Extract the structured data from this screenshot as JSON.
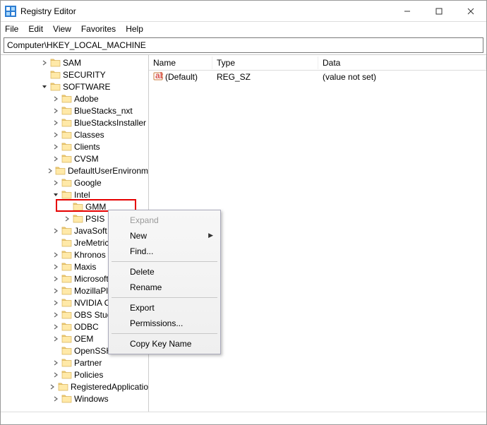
{
  "window": {
    "title": "Registry Editor"
  },
  "menu": {
    "file": "File",
    "edit": "Edit",
    "view": "View",
    "favorites": "Favorites",
    "help": "Help"
  },
  "address": "Computer\\HKEY_LOCAL_MACHINE",
  "list": {
    "headers": {
      "name": "Name",
      "type": "Type",
      "data": "Data"
    },
    "rows": [
      {
        "name": "(Default)",
        "type": "REG_SZ",
        "data": "(value not set)"
      }
    ]
  },
  "tree": {
    "sam": "SAM",
    "security": "SECURITY",
    "software": "SOFTWARE",
    "adobe": "Adobe",
    "bluestacks_nxt": "BlueStacks_nxt",
    "bluestacksinstaller": "BlueStacksInstaller",
    "classes": "Classes",
    "clients": "Clients",
    "cvsm": "CVSM",
    "defaultuserenv": "DefaultUserEnvironm",
    "google": "Google",
    "intel": "Intel",
    "gmm": "GMM",
    "psis": "PSIS",
    "javasoft": "JavaSoft",
    "jremetrics": "JreMetrics",
    "khronos": "Khronos",
    "maxis": "Maxis",
    "microsoft": "Microsoft",
    "mozillaplug": "MozillaPlug",
    "nvidiacor": "NVIDIA Cor",
    "obsstudio": "OBS Studio",
    "odbc": "ODBC",
    "oem": "OEM",
    "openssh": "OpenSSH",
    "partner": "Partner",
    "policies": "Policies",
    "registeredapp": "RegisteredApplicatio",
    "windows": "Windows"
  },
  "ctx": {
    "expand": "Expand",
    "new": "New",
    "find": "Find...",
    "delete": "Delete",
    "rename": "Rename",
    "export": "Export",
    "permissions": "Permissions...",
    "copykeyname": "Copy Key Name"
  }
}
